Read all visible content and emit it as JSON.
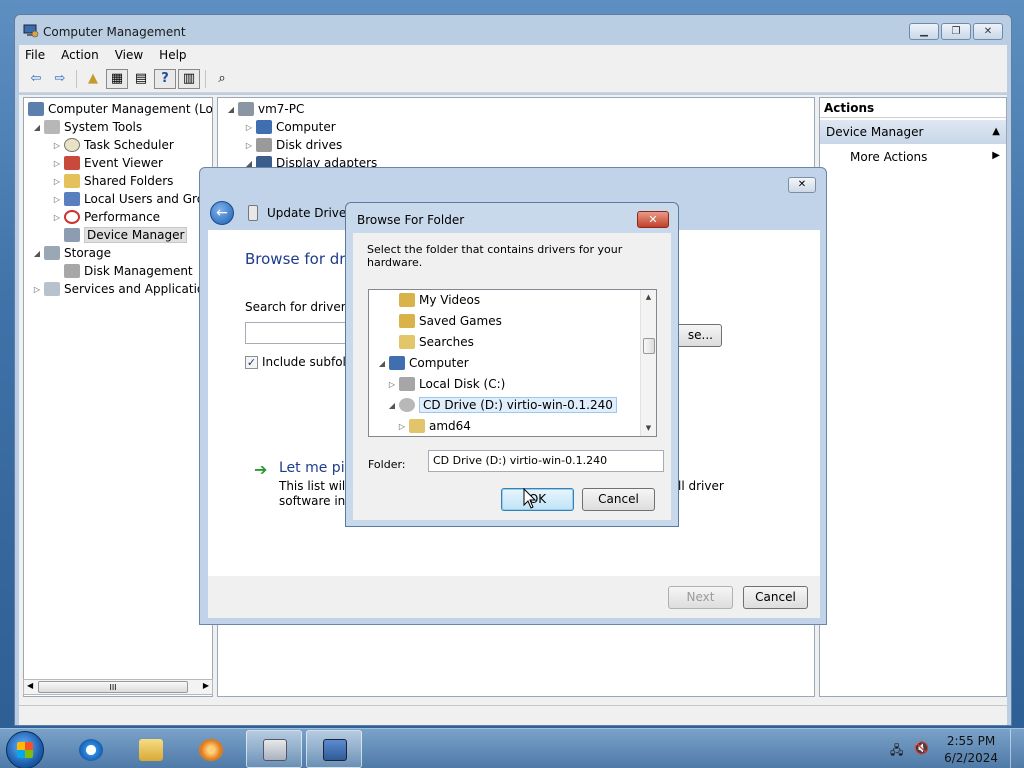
{
  "window": {
    "title": "Computer Management",
    "menu": [
      "File",
      "Action",
      "View",
      "Help"
    ]
  },
  "tree": {
    "root": "Computer Management (Local",
    "system_tools": "System Tools",
    "items": [
      "Task Scheduler",
      "Event Viewer",
      "Shared Folders",
      "Local Users and Group",
      "Performance",
      "Device Manager"
    ],
    "storage": "Storage",
    "disk_management": "Disk Management",
    "services": "Services and Applications",
    "scroll_grip": "III"
  },
  "devices": {
    "root": "vm7-PC",
    "items": [
      "Computer",
      "Disk drives",
      "Display adapters"
    ]
  },
  "actions": {
    "header": "Actions",
    "section": "Device Manager",
    "more": "More Actions"
  },
  "wizard": {
    "title": "Update Driver S",
    "heading": "Browse for driv",
    "search_label": "Search for driver so",
    "browse_label": "se...",
    "include_label": "Include subfolde",
    "pick_link": "Let me pic",
    "pick_desc": "This list will s",
    "pick_desc_2": "software in th",
    "pick_desc_right": "ll driver",
    "next": "Next",
    "cancel": "Cancel"
  },
  "browse_dialog": {
    "title": "Browse For Folder",
    "close": "✕",
    "description": "Select the folder that contains drivers for your hardware.",
    "tree": [
      "My Videos",
      "Saved Games",
      "Searches",
      "Computer",
      "Local Disk (C:)",
      "CD Drive (D:) virtio-win-0.1.240",
      "amd64"
    ],
    "folder_label": "Folder:",
    "folder_value": "CD Drive (D:) virtio-win-0.1.240",
    "ok": "OK",
    "cancel": "Cancel"
  },
  "clock": {
    "time": "2:55 PM",
    "date": "6/2/2024"
  }
}
